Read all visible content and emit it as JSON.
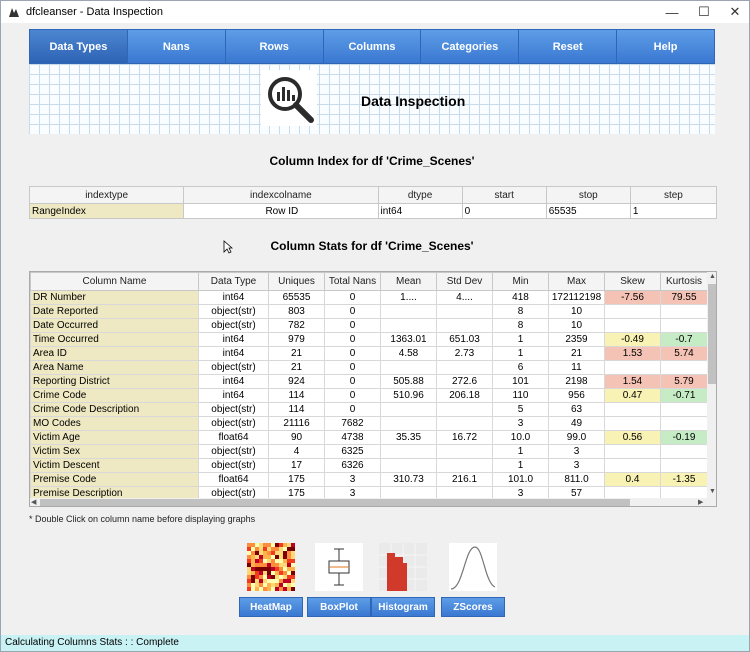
{
  "window": {
    "title": "dfcleanser - Data Inspection",
    "min": "—",
    "max": "☐",
    "close": "✕"
  },
  "nav": [
    "Data Types",
    "Nans",
    "Rows",
    "Columns",
    "Categories",
    "Reset",
    "Help"
  ],
  "banner": {
    "title": "Data Inspection"
  },
  "column_index": {
    "title": "Column Index for df 'Crime_Scenes'",
    "headers": [
      "indextype",
      "indexcolname",
      "dtype",
      "start",
      "stop",
      "step"
    ],
    "row": [
      "RangeIndex",
      "Row ID",
      "int64",
      "0",
      "65535",
      "1"
    ]
  },
  "column_stats": {
    "title": "Column Stats for df 'Crime_Scenes'",
    "headers": [
      "Column Name",
      "Data Type",
      "Uniques",
      "Total Nans",
      "Mean",
      "Std Dev",
      "Min",
      "Max",
      "Skew",
      "Kurtosis"
    ],
    "rows": [
      [
        "DR Number",
        "int64",
        "65535",
        "0",
        "1....",
        "4....",
        "418",
        "172112198",
        "-7.56",
        "79.55"
      ],
      [
        "Date Reported",
        "object(str)",
        "803",
        "0",
        "",
        "",
        "8",
        "10",
        "",
        ""
      ],
      [
        "Date Occurred",
        "object(str)",
        "782",
        "0",
        "",
        "",
        "8",
        "10",
        "",
        ""
      ],
      [
        "Time Occurred",
        "int64",
        "979",
        "0",
        "1363.01",
        "651.03",
        "1",
        "2359",
        "-0.49",
        "-0.7"
      ],
      [
        "Area ID",
        "int64",
        "21",
        "0",
        "4.58",
        "2.73",
        "1",
        "21",
        "1.53",
        "5.74"
      ],
      [
        "Area Name",
        "object(str)",
        "21",
        "0",
        "",
        "",
        "6",
        "11",
        "",
        ""
      ],
      [
        "Reporting District",
        "int64",
        "924",
        "0",
        "505.88",
        "272.6",
        "101",
        "2198",
        "1.54",
        "5.79"
      ],
      [
        "Crime Code",
        "int64",
        "114",
        "0",
        "510.96",
        "206.18",
        "110",
        "956",
        "0.47",
        "-0.71"
      ],
      [
        "Crime Code Description",
        "object(str)",
        "114",
        "0",
        "",
        "",
        "5",
        "63",
        "",
        ""
      ],
      [
        "MO Codes",
        "object(str)",
        "21116",
        "7682",
        "",
        "",
        "3",
        "49",
        "",
        ""
      ],
      [
        "Victim Age",
        "float64",
        "90",
        "4738",
        "35.35",
        "16.72",
        "10.0",
        "99.0",
        "0.56",
        "-0.19"
      ],
      [
        "Victim Sex",
        "object(str)",
        "4",
        "6325",
        "",
        "",
        "1",
        "3",
        "",
        ""
      ],
      [
        "Victim Descent",
        "object(str)",
        "17",
        "6326",
        "",
        "",
        "1",
        "3",
        "",
        ""
      ],
      [
        "Premise Code",
        "float64",
        "175",
        "3",
        "310.73",
        "216.1",
        "101.0",
        "811.0",
        "0.4",
        "-1.35"
      ],
      [
        "Premise Description",
        "object(str)",
        "175",
        "3",
        "",
        "",
        "3",
        "57",
        "",
        ""
      ]
    ],
    "highlights": {
      "0": [
        "red",
        "red"
      ],
      "3": [
        "yellow",
        "green"
      ],
      "4": [
        "red",
        "red"
      ],
      "6": [
        "red",
        "red"
      ],
      "7": [
        "yellow",
        "green"
      ],
      "10": [
        "yellow",
        "green"
      ],
      "13": [
        "yellow",
        "yellow"
      ]
    }
  },
  "footnote": "* Double Click on column name before displaying graphs",
  "graph_buttons": [
    "HeatMap",
    "BoxPlot",
    "Histogram",
    "ZScores"
  ],
  "status": "Calculating Columns Stats : : Complete",
  "colors": {
    "accent": "#3a78d2",
    "name_cell": "#efe9c3",
    "status_bg": "#c9f2f4",
    "red": "#f4c3b5",
    "yellow": "#f8f2b4",
    "green": "#c6ecc6"
  }
}
